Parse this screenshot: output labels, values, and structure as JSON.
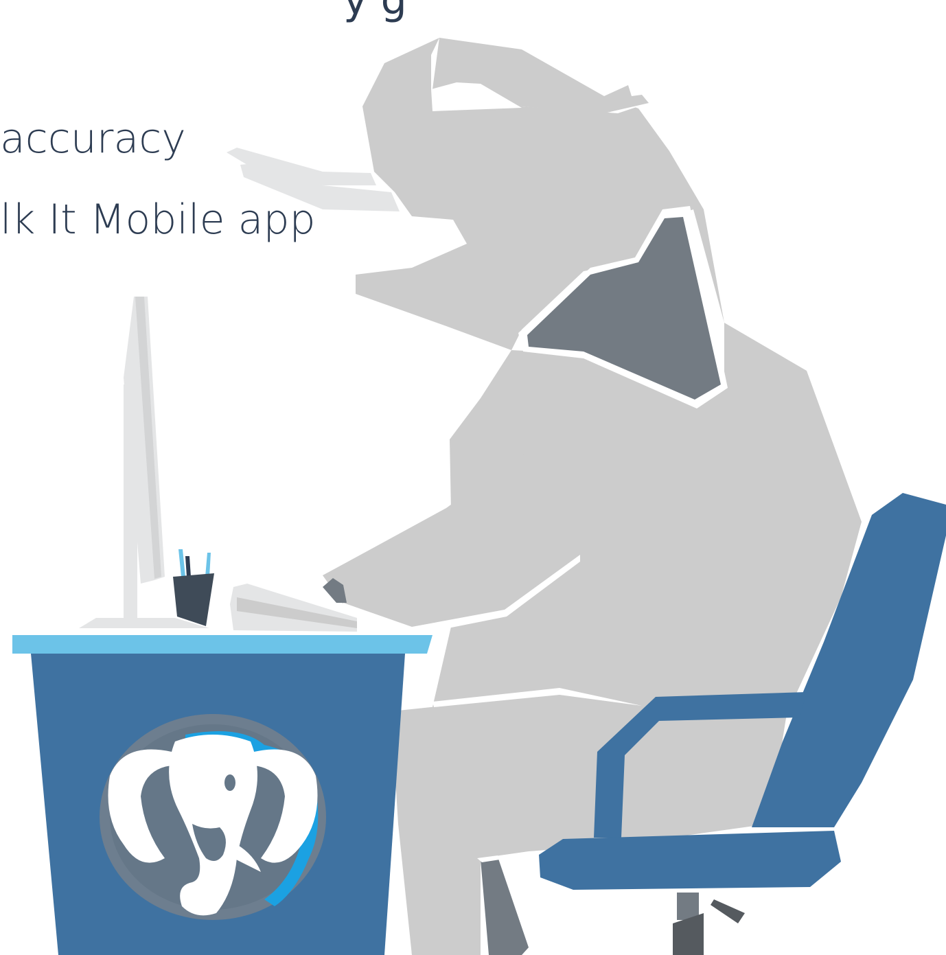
{
  "text_lines": {
    "top_partial": "y g",
    "line_1": "accuracy",
    "line_2": "lk It Mobile app"
  },
  "colors": {
    "text": "#2d3c52",
    "elephant_body": "#cccccc",
    "elephant_ear": "#737b83",
    "desk_body": "#3f72a1",
    "desk_top": "#6cc3e8",
    "chair": "#3f72a1",
    "logo_elephant": "#657788",
    "logo_ring": "#1ba1e2"
  },
  "illustration": {
    "subject": "elephant-at-desk",
    "logo": "postgresql-elephant-logo"
  }
}
